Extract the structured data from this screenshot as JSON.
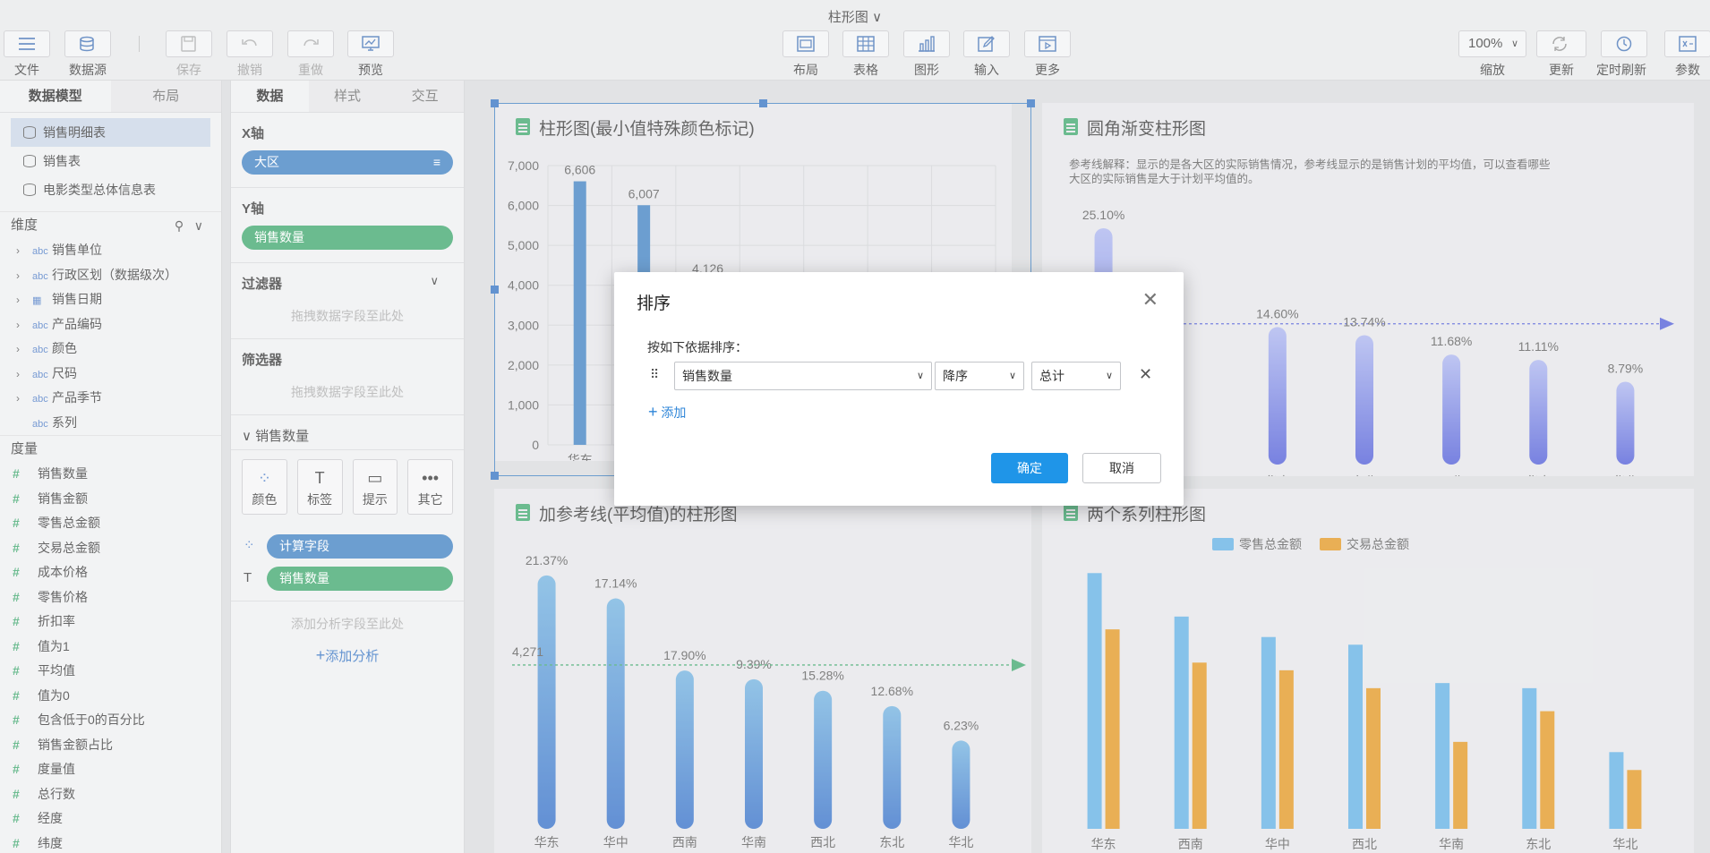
{
  "doc_title": "柱形图 ∨",
  "toolbar": {
    "file": "文件",
    "datasource": "数据源",
    "save": "保存",
    "undo": "撤销",
    "redo": "重做",
    "preview": "预览",
    "layout": "布局",
    "table": "表格",
    "graph": "图形",
    "input": "输入",
    "more": "更多",
    "zoom_value": "100%",
    "zoom": "缩放",
    "refresh": "更新",
    "timed_refresh": "定时刷新",
    "params": "参数"
  },
  "left_panel": {
    "tabs": [
      "数据模型",
      "布局"
    ],
    "tables": [
      "销售明细表",
      "销售表",
      "电影类型总体信息表"
    ],
    "dim_header": "维度",
    "dimensions": [
      {
        "type": "abc",
        "name": "销售单位"
      },
      {
        "type": "abc",
        "name": "行政区划（数据级次）"
      },
      {
        "type": "date",
        "name": "销售日期"
      },
      {
        "type": "abc",
        "name": "产品编码"
      },
      {
        "type": "abc",
        "name": "颜色"
      },
      {
        "type": "abc",
        "name": "尺码"
      },
      {
        "type": "abc",
        "name": "产品季节"
      },
      {
        "type": "abc",
        "name": "系列"
      }
    ],
    "measure_header": "度量",
    "measures": [
      "销售数量",
      "销售金额",
      "零售总金额",
      "交易总金额",
      "成本价格",
      "零售价格",
      "折扣率",
      "值为1",
      "平均值",
      "值为0",
      "包含低于0的百分比",
      "销售金额占比",
      "度量值",
      "总行数",
      "经度",
      "纬度"
    ]
  },
  "mid_panel": {
    "tabs": [
      "数据",
      "样式",
      "交互"
    ],
    "x_axis": "X轴",
    "x_field": "大区",
    "y_axis": "Y轴",
    "y_field": "销售数量",
    "filter": "过滤器",
    "filter_drop": "拖拽数据字段至此处",
    "screen": "筛选器",
    "screen_drop": "拖拽数据字段至此处",
    "measure_section": "销售数量",
    "tools": [
      "颜色",
      "标签",
      "提示",
      "其它"
    ],
    "color_field": "计算字段",
    "label_field": "销售数量",
    "analysis_drop": "添加分析字段至此处",
    "add_analysis": "添加分析"
  },
  "charts": {
    "c1_title": "柱形图(最小值特殊颜色标记)",
    "c2_title": "圆角渐变柱形图",
    "c2_note": "参考线解释：显示的是各大区的实际销售情况，参考线显示的是销售计划的平均值，可以查看哪些大区的实际销售是大于计划平均值的。",
    "c3_title": "加参考线(平均值)的柱形图",
    "c4_title": "两个系列柱形图",
    "legend": [
      "零售总金额",
      "交易总金额"
    ]
  },
  "chart_data": [
    {
      "type": "bar",
      "title": "柱形图(最小值特殊颜色标记)",
      "ylim": [
        0,
        7000
      ],
      "yticks": [
        "7,000",
        "6,000",
        "5,000",
        "4,000",
        "3,000",
        "2,000",
        "1,000",
        "0"
      ],
      "categories": [
        "华东",
        "",
        "",
        "",
        "",
        "",
        ""
      ],
      "values": [
        6606,
        6007,
        4126,
        null,
        null,
        null,
        null
      ],
      "labels": [
        "6,606",
        "6,007",
        "4,126"
      ]
    },
    {
      "type": "bar",
      "title": "圆角渐变柱形图",
      "categories": [
        "",
        "",
        "华中",
        "东北",
        "西北",
        "华南",
        "华北"
      ],
      "values": [
        25.1,
        null,
        14.6,
        13.74,
        11.68,
        11.11,
        8.79
      ],
      "labels": [
        "25.10%",
        "",
        "14.60%",
        "13.74%",
        "11.68%",
        "11.11%",
        "8.79%"
      ]
    },
    {
      "type": "bar",
      "title": "加参考线(平均值)的柱形图",
      "categories": [
        "华东",
        "华中",
        "西南",
        "华南",
        "西北",
        "东北",
        "华北"
      ],
      "values": [
        6606,
        6007,
        4126,
        3900,
        3600,
        3200,
        2300
      ],
      "labels": [
        "21.37%",
        "17.14%",
        "17.90%",
        "9.39%",
        "15.28%",
        "12.68%",
        "6.23%"
      ],
      "reference": 4271,
      "reference_label": "4,271"
    },
    {
      "type": "bar",
      "title": "两个系列柱形图",
      "categories": [
        "华东",
        "西南",
        "华中",
        "西北",
        "华南",
        "东北",
        "华北"
      ],
      "series": [
        {
          "name": "零售总金额",
          "values": [
            100,
            83,
            75,
            72,
            57,
            55,
            30
          ]
        },
        {
          "name": "交易总金额",
          "values": [
            78,
            65,
            62,
            55,
            34,
            46,
            23
          ]
        }
      ]
    }
  ],
  "dialog": {
    "title": "排序",
    "subtitle": "按如下依据排序：",
    "field": "销售数量",
    "order": "降序",
    "scope": "总计",
    "add": "添加",
    "ok": "确定",
    "cancel": "取消"
  },
  "colors": {
    "blue_bar": "#3b7ec0",
    "green": "#3aa56a",
    "purple_top": "#a9b3ee",
    "purple_bottom": "#4b58d6",
    "series1": "#5eaee3",
    "series2": "#e2951d",
    "primary_button": "#1f95e8"
  }
}
